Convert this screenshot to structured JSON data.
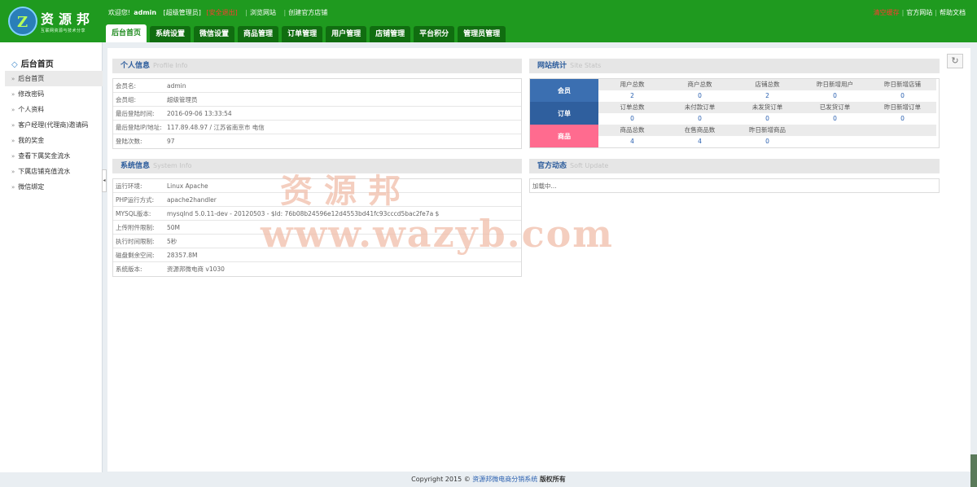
{
  "logo": {
    "mark": "Z",
    "name": "资源邦",
    "tagline": "互联网资源与技术分享"
  },
  "topbar": {
    "welcome": "欢迎您!",
    "username": "admin",
    "role": "[超级管理员]",
    "logout": "[安全退出]",
    "browse_site": "浏览网站",
    "create_shop": "创建官方店铺"
  },
  "topright": {
    "clear_cache": "清空缓存",
    "official_site": "官方网站",
    "help_docs": "帮助文档"
  },
  "nav": {
    "tabs": [
      "后台首页",
      "系统设置",
      "微信设置",
      "商品管理",
      "订单管理",
      "用户管理",
      "店铺管理",
      "平台积分",
      "管理员管理"
    ],
    "active": 0
  },
  "sidebar": {
    "title": "后台首页",
    "items": [
      "后台首页",
      "修改密码",
      "个人资料",
      "客户经理(代理商)邀请码",
      "我的奖金",
      "查看下属奖金流水",
      "下属店铺充值流水",
      "微信绑定"
    ]
  },
  "profile": {
    "title": "个人信息",
    "title_en": "Profile Info",
    "rows": [
      {
        "k": "会员名:",
        "v": "admin"
      },
      {
        "k": "会员组:",
        "v": "超级管理员"
      },
      {
        "k": "最后登陆时间:",
        "v": "2016-09-06 13:33:54"
      },
      {
        "k": "最后登陆IP/地址:",
        "v": "117.89.48.97 / 江苏省南京市 电信"
      },
      {
        "k": "登陆次数:",
        "v": "97"
      }
    ]
  },
  "system": {
    "title": "系统信息",
    "title_en": "System Info",
    "rows": [
      {
        "k": "运行环境:",
        "v": "Linux Apache"
      },
      {
        "k": "PHP运行方式:",
        "v": "apache2handler"
      },
      {
        "k": "MYSQL版本:",
        "v": "mysqlnd 5.0.11-dev - 20120503 - $Id: 76b08b24596e12d4553bd41fc93cccd5bac2fe7a $"
      },
      {
        "k": "上传附件限制:",
        "v": "50M"
      },
      {
        "k": "执行时间限制:",
        "v": "5秒"
      },
      {
        "k": "磁盘剩余空间:",
        "v": "28357.8M"
      },
      {
        "k": "系统版本:",
        "v": "资源邦微电商 v1030"
      }
    ]
  },
  "stats": {
    "title": "网站统计",
    "title_en": "Site Stats",
    "rows": [
      {
        "label": "会员",
        "color": "#3b6fb1",
        "cells": [
          {
            "lbl": "用户总数",
            "num": "2"
          },
          {
            "lbl": "商户总数",
            "num": "0"
          },
          {
            "lbl": "店铺总数",
            "num": "2"
          },
          {
            "lbl": "昨日新增用户",
            "num": "0"
          },
          {
            "lbl": "昨日新增店铺",
            "num": "0"
          }
        ]
      },
      {
        "label": "订单",
        "color": "#2f5f9e",
        "cells": [
          {
            "lbl": "订单总数",
            "num": "0"
          },
          {
            "lbl": "未付款订单",
            "num": "0"
          },
          {
            "lbl": "未发货订单",
            "num": "0"
          },
          {
            "lbl": "已发货订单",
            "num": "0"
          },
          {
            "lbl": "昨日新增订单",
            "num": "0"
          }
        ]
      },
      {
        "label": "商品",
        "color": "#ff6b8f",
        "cells": [
          {
            "lbl": "商品总数",
            "num": "4"
          },
          {
            "lbl": "在售商品数",
            "num": "4"
          },
          {
            "lbl": "昨日新增商品",
            "num": "0"
          },
          {
            "lbl": "",
            "num": ""
          },
          {
            "lbl": "",
            "num": ""
          }
        ]
      }
    ]
  },
  "updates": {
    "title": "官方动态",
    "title_en": "Soft Update",
    "loading": "加载中..."
  },
  "watermark": {
    "line1": "资源邦",
    "line2": "www.wazyb.com"
  },
  "footer": {
    "copyright": "Copyright 2015 ©",
    "link": "资源邦微电商分销系统",
    "rights": "版权所有"
  }
}
